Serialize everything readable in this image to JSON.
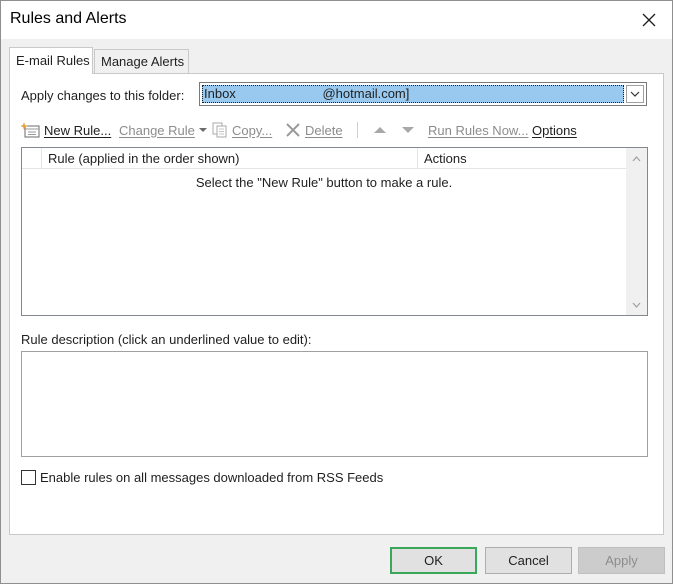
{
  "window": {
    "title": "Rules and Alerts"
  },
  "tabs": [
    {
      "label": "E-mail Rules",
      "active": true
    },
    {
      "label": "Manage Alerts",
      "active": false
    }
  ],
  "folder": {
    "label": "Apply changes to this folder:",
    "value": "Inbox                        @hotmail.com]"
  },
  "toolbar": {
    "new_rule": "New Rule...",
    "change_rule": "Change Rule",
    "copy": "Copy...",
    "delete": "Delete",
    "run_rules_now": "Run Rules Now...",
    "options": "Options"
  },
  "rules_list": {
    "columns": [
      "Rule (applied in the order shown)",
      "Actions"
    ],
    "empty_message": "Select the \"New Rule\" button to make a rule."
  },
  "description": {
    "label": "Rule description (click an underlined value to edit):"
  },
  "rss": {
    "label": "Enable rules on all messages downloaded from RSS Feeds",
    "checked": false
  },
  "buttons": {
    "ok": "OK",
    "cancel": "Cancel",
    "apply": "Apply"
  },
  "colors": {
    "selection": "#99c9ef",
    "ok_border": "#3aa85b",
    "disabled_text": "#8c8c8c"
  }
}
